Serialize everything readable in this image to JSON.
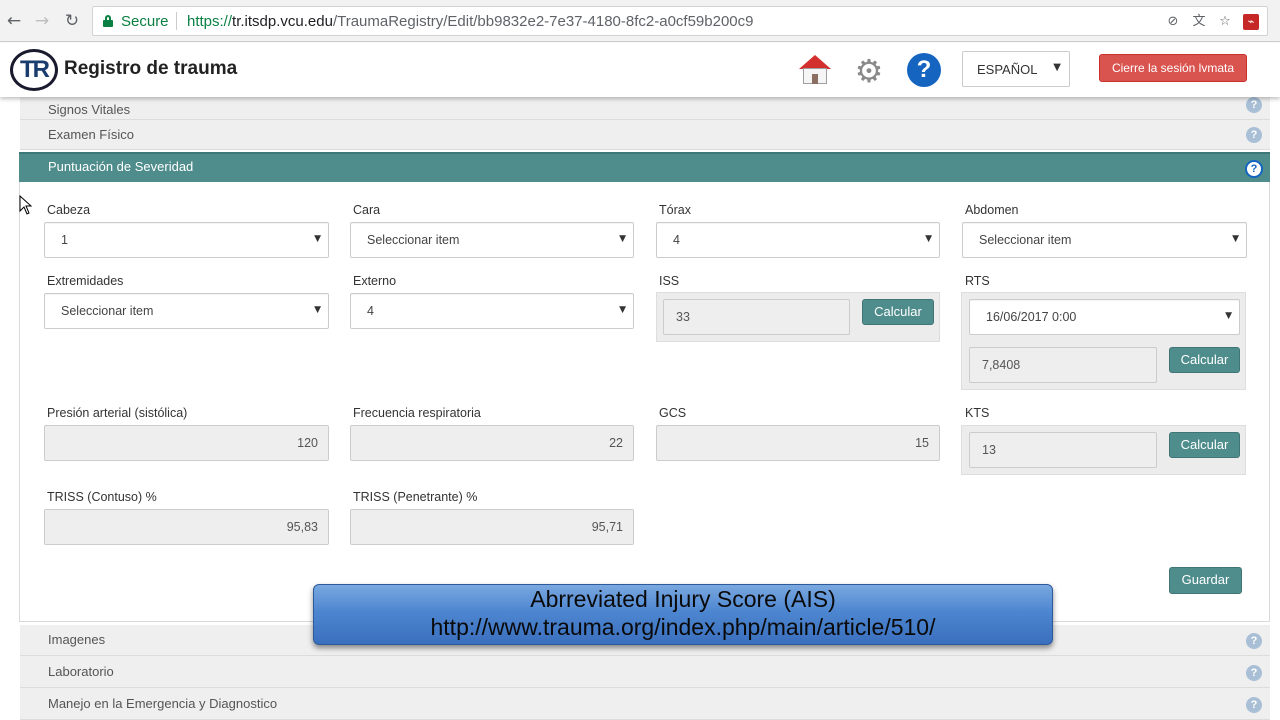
{
  "browser": {
    "secure_label": "Secure",
    "url_scheme": "https://",
    "url_host": "tr.itsdp.vcu.edu",
    "url_path": "/TraumaRegistry/Edit/bb9832e2-7e37-4180-8fc2-a0cf59b200c9"
  },
  "header": {
    "logo_text": "TR",
    "title": "Registro de trauma",
    "language": "ESPAÑOL",
    "logout_label": "Cierre la sesión lvmata"
  },
  "accordion_top": [
    {
      "label": "Signos Vitales"
    },
    {
      "label": "Examen Físico"
    }
  ],
  "active_section": {
    "label": "Puntuación de Severidad"
  },
  "fields": {
    "cabeza": {
      "label": "Cabeza",
      "value": "1"
    },
    "cara": {
      "label": "Cara",
      "value": "Seleccionar item"
    },
    "torax": {
      "label": "Tórax",
      "value": "4"
    },
    "abdomen": {
      "label": "Abdomen",
      "value": "Seleccionar item"
    },
    "extremidades": {
      "label": "Extremidades",
      "value": "Seleccionar item"
    },
    "externo": {
      "label": "Externo",
      "value": "4"
    },
    "iss": {
      "label": "ISS",
      "value": "33",
      "button": "Calcular"
    },
    "rts": {
      "label": "RTS",
      "date": "16/06/2017 0:00",
      "value": "7,8408",
      "button": "Calcular"
    },
    "presion": {
      "label": "Presión arterial (sistólica)",
      "value": "120"
    },
    "frecuencia": {
      "label": "Frecuencia respiratoria",
      "value": "22"
    },
    "gcs": {
      "label": "GCS",
      "value": "15"
    },
    "kts": {
      "label": "KTS",
      "value": "13",
      "button": "Calcular"
    },
    "triss_contuso": {
      "label": "TRISS (Contuso) %",
      "value": "95,83"
    },
    "triss_penetrante": {
      "label": "TRISS (Penetrante) %",
      "value": "95,71"
    }
  },
  "save_label": "Guardar",
  "accordion_bottom": [
    {
      "label": "Imagenes"
    },
    {
      "label": "Laboratorio"
    },
    {
      "label": "Manejo en la Emergencia y Diagnostico"
    }
  ],
  "caption": {
    "line1": "Abrreviated Injury Score (AIS)",
    "line2": "http://www.trauma.org/index.php/main/article/510/"
  },
  "colors": {
    "teal": "#4f8d8c",
    "logout_red": "#d9534f",
    "help_blue": "#1565c0"
  }
}
